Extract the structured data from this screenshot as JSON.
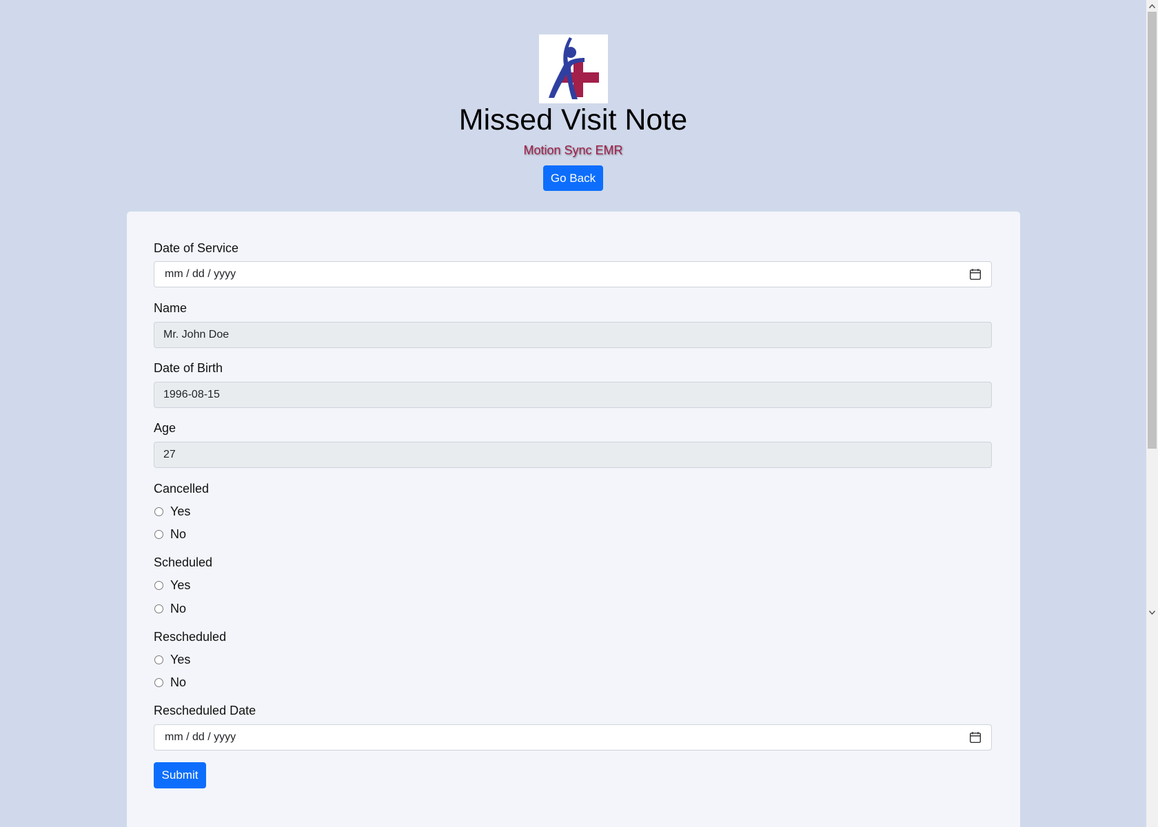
{
  "header": {
    "title": "Missed Visit Note",
    "subtitle": "Motion Sync EMR",
    "go_back_label": "Go Back"
  },
  "colors": {
    "page_background": "#d0d9eb",
    "card_background": "#f3f5fa",
    "primary_button": "#0d6efd",
    "subtitle_color": "#a3204a",
    "logo_figure_blue": "#2f3fa0",
    "logo_cross_red": "#a3204a"
  },
  "form": {
    "date_of_service": {
      "label": "Date of Service",
      "value": "mm / dd / yyyy",
      "icon": "calendar-icon"
    },
    "name": {
      "label": "Name",
      "value": "Mr. John Doe"
    },
    "date_of_birth": {
      "label": "Date of Birth",
      "value": "1996-08-15"
    },
    "age": {
      "label": "Age",
      "value": "27"
    },
    "cancelled": {
      "label": "Cancelled",
      "options": [
        "Yes",
        "No"
      ]
    },
    "scheduled": {
      "label": "Scheduled",
      "options": [
        "Yes",
        "No"
      ]
    },
    "rescheduled": {
      "label": "Rescheduled",
      "options": [
        "Yes",
        "No"
      ]
    },
    "rescheduled_date": {
      "label": "Rescheduled Date",
      "value": "mm / dd / yyyy",
      "icon": "calendar-icon"
    },
    "submit_label": "Submit"
  }
}
